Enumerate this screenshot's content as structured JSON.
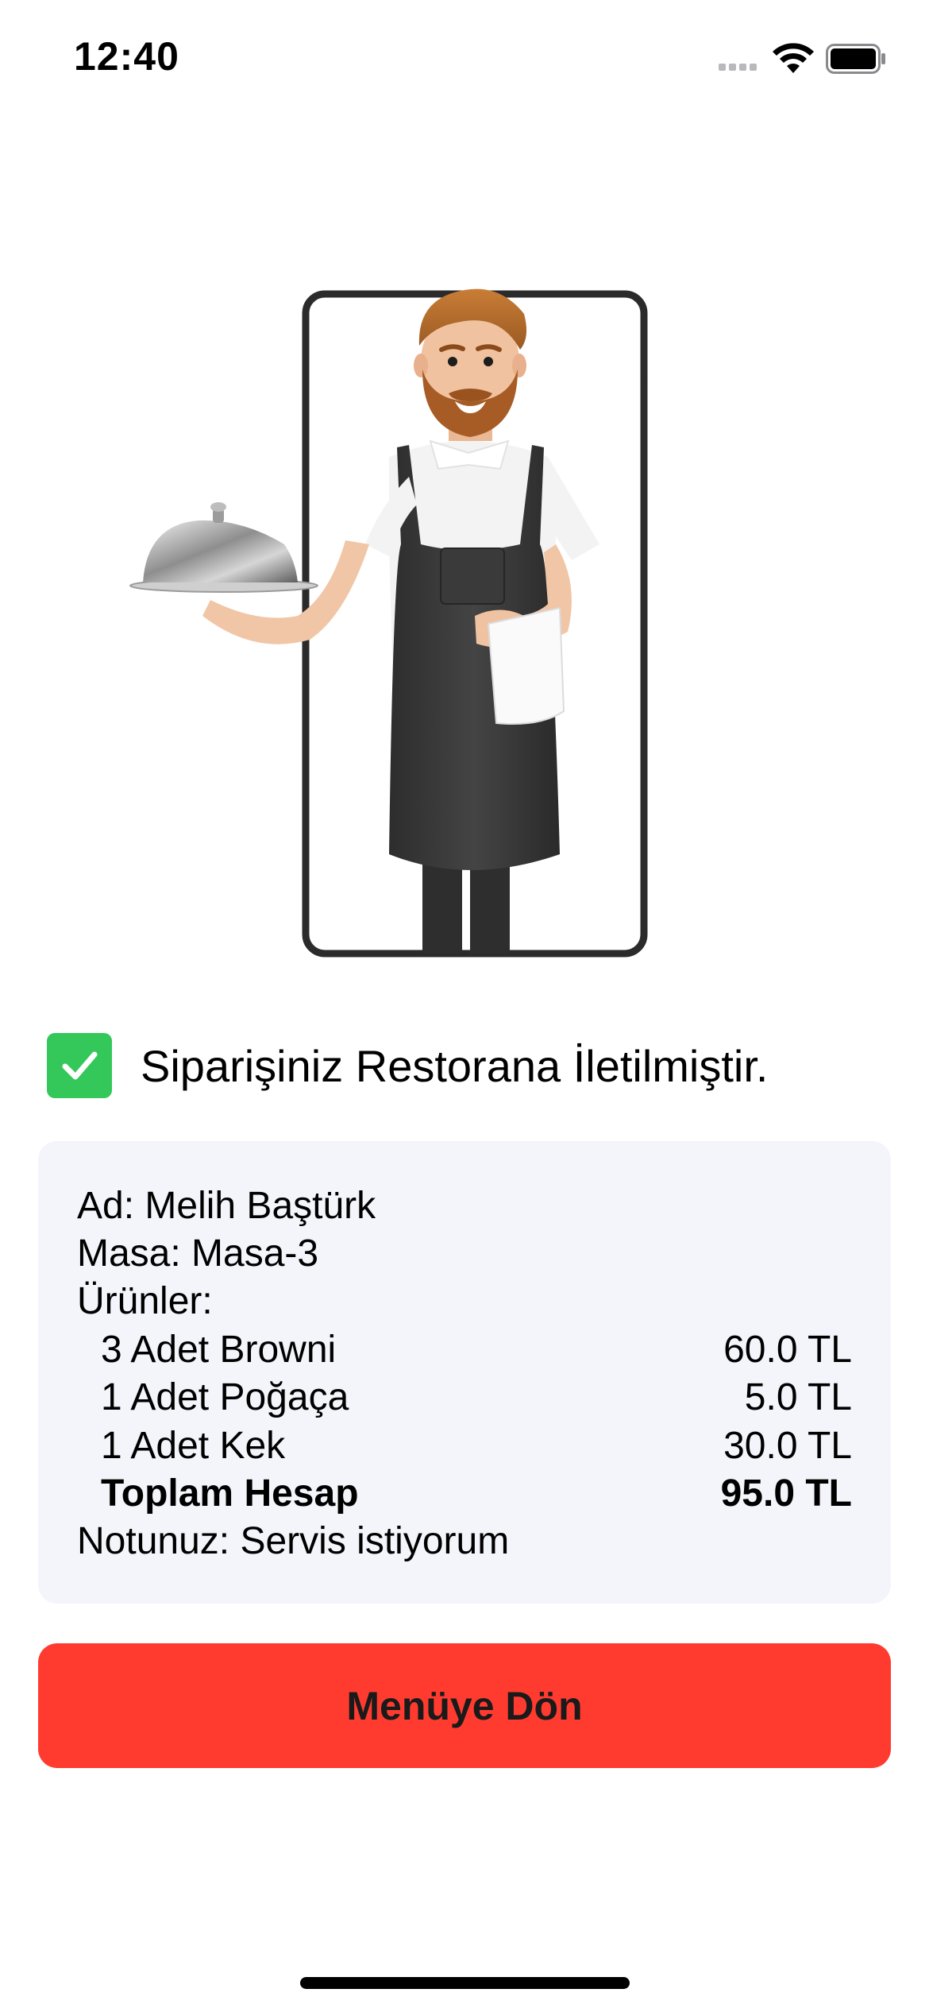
{
  "status_bar": {
    "time": "12:40",
    "icons": [
      "cellular-signal-icon",
      "wifi-icon",
      "battery-icon"
    ]
  },
  "illustration": {
    "icon": "waiter-with-phone-illustration"
  },
  "confirmation": {
    "icon": "checkmark-icon",
    "message": "Siparişiniz Restorana İletilmiştir.",
    "accent_color": "#34c759"
  },
  "summary": {
    "name_line": "Ad: Melih Baştürk",
    "table_line": "Masa: Masa-3",
    "products_header": "Ürünler:",
    "items": [
      {
        "label": "3 Adet Browni",
        "price": "60.0 TL"
      },
      {
        "label": "1 Adet Poğaça",
        "price": "5.0 TL"
      },
      {
        "label": "1 Adet Kek",
        "price": "30.0 TL"
      }
    ],
    "total_label": "Toplam Hesap",
    "total_value": "95.0 TL",
    "note_line": "Notunuz: Servis istiyorum"
  },
  "actions": {
    "back_label": "Menüye Dön",
    "button_color": "#ff3b30"
  }
}
